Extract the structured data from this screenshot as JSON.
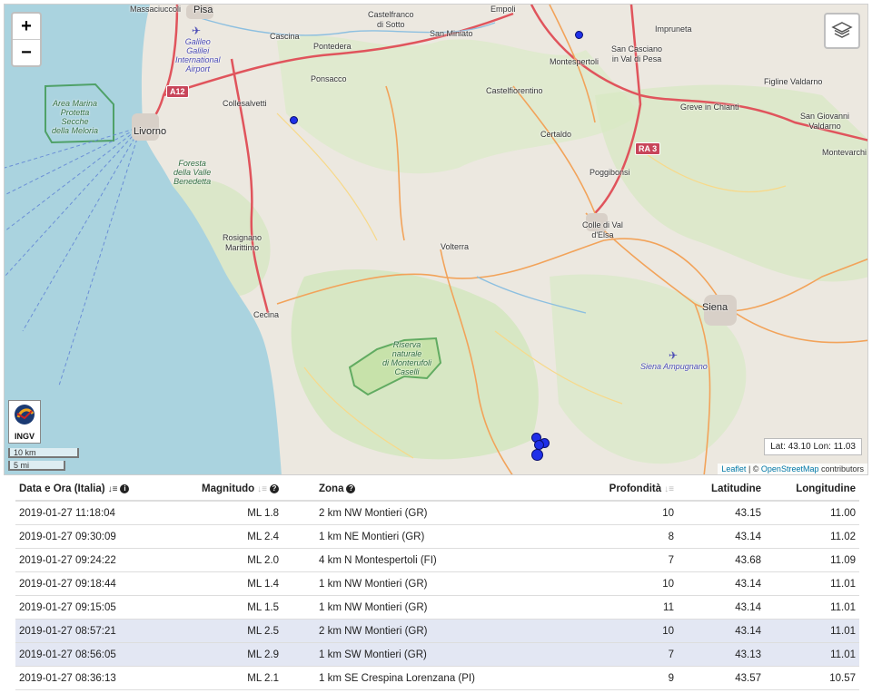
{
  "map": {
    "zoom_in": "+",
    "zoom_out": "−",
    "layers_icon": "layers-icon",
    "logo_text": "INGV",
    "scale_km": "10 km",
    "scale_mi": "5 mi",
    "coords": "Lat: 43.10 Lon: 11.03",
    "attribution": {
      "leaflet": "Leaflet",
      "sep": " | © ",
      "osm": "OpenStreetMap",
      "suffix": " contributors"
    },
    "places": [
      {
        "key": "massaciuccoli",
        "text": "Massaciuccoli"
      },
      {
        "key": "pisa",
        "text": "Pisa"
      },
      {
        "key": "cascina",
        "text": "Cascina"
      },
      {
        "key": "pontedera",
        "text": "Pontedera"
      },
      {
        "key": "castelfranco",
        "text": "Castelfranco\ndi Sotto"
      },
      {
        "key": "sanminiato",
        "text": "San Miniato"
      },
      {
        "key": "empoli",
        "text": "Empoli"
      },
      {
        "key": "impruneta",
        "text": "Impruneta"
      },
      {
        "key": "sancasciano",
        "text": "San Casciano\nin Val di Pesa"
      },
      {
        "key": "montespertoli",
        "text": "Montespertoli"
      },
      {
        "key": "ponsacco",
        "text": "Ponsacco"
      },
      {
        "key": "collesalvetti",
        "text": "Collesalvetti"
      },
      {
        "key": "castelfiorentino",
        "text": "Castelfiorentino"
      },
      {
        "key": "figline",
        "text": "Figline Valdarno"
      },
      {
        "key": "greve",
        "text": "Greve in Chianti"
      },
      {
        "key": "sangiovanni",
        "text": "San Giovanni\nValdarno"
      },
      {
        "key": "livorno",
        "text": "Livorno"
      },
      {
        "key": "certaldo",
        "text": "Certaldo"
      },
      {
        "key": "montevarchi",
        "text": "Montevarchi"
      },
      {
        "key": "poggibonsi",
        "text": "Poggibonsi"
      },
      {
        "key": "colle",
        "text": "Colle di Val\nd'Elsa"
      },
      {
        "key": "rosignano",
        "text": "Rosignano\nMarittimo"
      },
      {
        "key": "volterra",
        "text": "Volterra"
      },
      {
        "key": "siena",
        "text": "Siena"
      },
      {
        "key": "cecina",
        "text": "Cecina"
      }
    ],
    "green_labels": [
      {
        "key": "meloria",
        "text": "Area Marina\nProtetta\nSecche\ndella Meloria"
      },
      {
        "key": "foresta",
        "text": "Foresta\ndella Valle\nBenedetta"
      },
      {
        "key": "riserva",
        "text": "Riserva\nnaturale\ndi Monterufoli\nCaselli"
      }
    ],
    "airports": [
      {
        "key": "pisa_airport",
        "text": "Galileo\nGalilei\nInternational\nAirport"
      },
      {
        "key": "siena_airport",
        "text": "Siena Ampugnano"
      }
    ],
    "road_shields": [
      {
        "key": "a12",
        "text": "A12"
      },
      {
        "key": "ra3",
        "text": "RA 3"
      }
    ],
    "markers_count_note": ""
  },
  "table": {
    "headers": {
      "datetime": "Data e Ora (Italia)",
      "magnitude": "Magnitudo",
      "zone": "Zona",
      "depth": "Profondità",
      "lat": "Latitudine",
      "lon": "Longitudine"
    },
    "rows": [
      {
        "datetime": "2019-01-27 11:18:04",
        "magnitude": "ML 1.8",
        "zone": "2 km NW Montieri (GR)",
        "depth": "10",
        "lat": "43.15",
        "lon": "11.00",
        "highlight": false
      },
      {
        "datetime": "2019-01-27 09:30:09",
        "magnitude": "ML 2.4",
        "zone": "1 km NE Montieri (GR)",
        "depth": "8",
        "lat": "43.14",
        "lon": "11.02",
        "highlight": false
      },
      {
        "datetime": "2019-01-27 09:24:22",
        "magnitude": "ML 2.0",
        "zone": "4 km N Montespertoli (FI)",
        "depth": "7",
        "lat": "43.68",
        "lon": "11.09",
        "highlight": false
      },
      {
        "datetime": "2019-01-27 09:18:44",
        "magnitude": "ML 1.4",
        "zone": "1 km NW Montieri (GR)",
        "depth": "10",
        "lat": "43.14",
        "lon": "11.01",
        "highlight": false
      },
      {
        "datetime": "2019-01-27 09:15:05",
        "magnitude": "ML 1.5",
        "zone": "1 km NW Montieri (GR)",
        "depth": "11",
        "lat": "43.14",
        "lon": "11.01",
        "highlight": false
      },
      {
        "datetime": "2019-01-27 08:57:21",
        "magnitude": "ML 2.5",
        "zone": "2 km NW Montieri (GR)",
        "depth": "10",
        "lat": "43.14",
        "lon": "11.01",
        "highlight": true
      },
      {
        "datetime": "2019-01-27 08:56:05",
        "magnitude": "ML 2.9",
        "zone": "1 km SW Montieri (GR)",
        "depth": "7",
        "lat": "43.13",
        "lon": "11.01",
        "highlight": true
      },
      {
        "datetime": "2019-01-27 08:36:13",
        "magnitude": "ML 2.1",
        "zone": "1 km SE Crespina Lorenzana (PI)",
        "depth": "9",
        "lat": "43.57",
        "lon": "10.57",
        "highlight": false
      }
    ]
  }
}
